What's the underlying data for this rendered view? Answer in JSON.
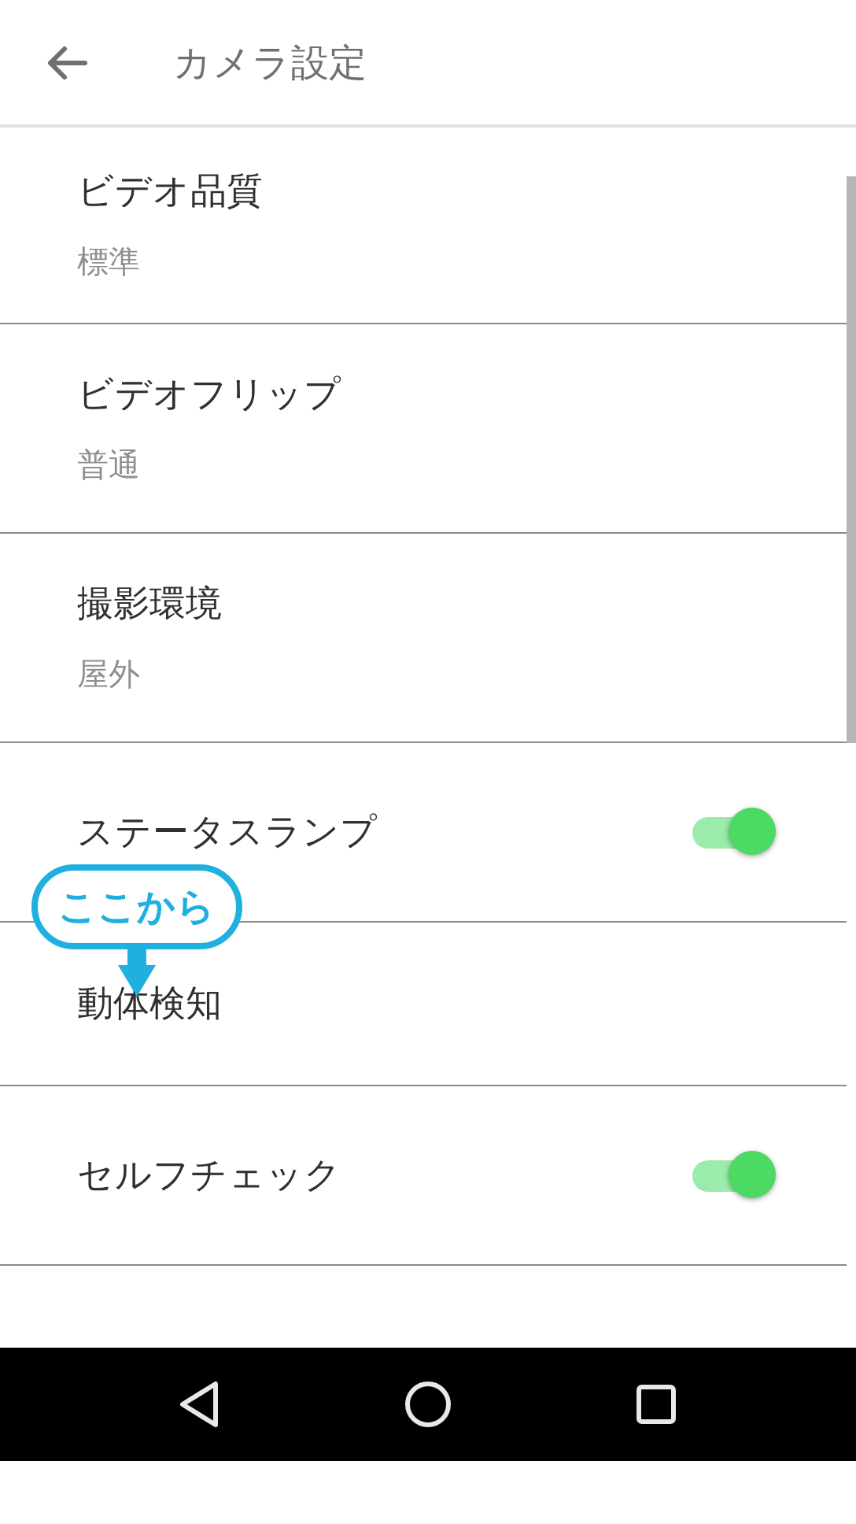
{
  "header": {
    "title": "カメラ設定"
  },
  "settings": [
    {
      "kind": "detail",
      "title": "ビデオ品質",
      "value": "標準"
    },
    {
      "kind": "detail",
      "title": "ビデオフリップ",
      "value": "普通"
    },
    {
      "kind": "detail",
      "title": "撮影環境",
      "value": "屋外"
    },
    {
      "kind": "toggle",
      "title": "ステータスランプ",
      "on": true
    },
    {
      "kind": "plain",
      "title": "動体検知"
    },
    {
      "kind": "toggle",
      "title": "セルフチェック",
      "on": true
    }
  ],
  "callout": {
    "text": "ここから"
  }
}
